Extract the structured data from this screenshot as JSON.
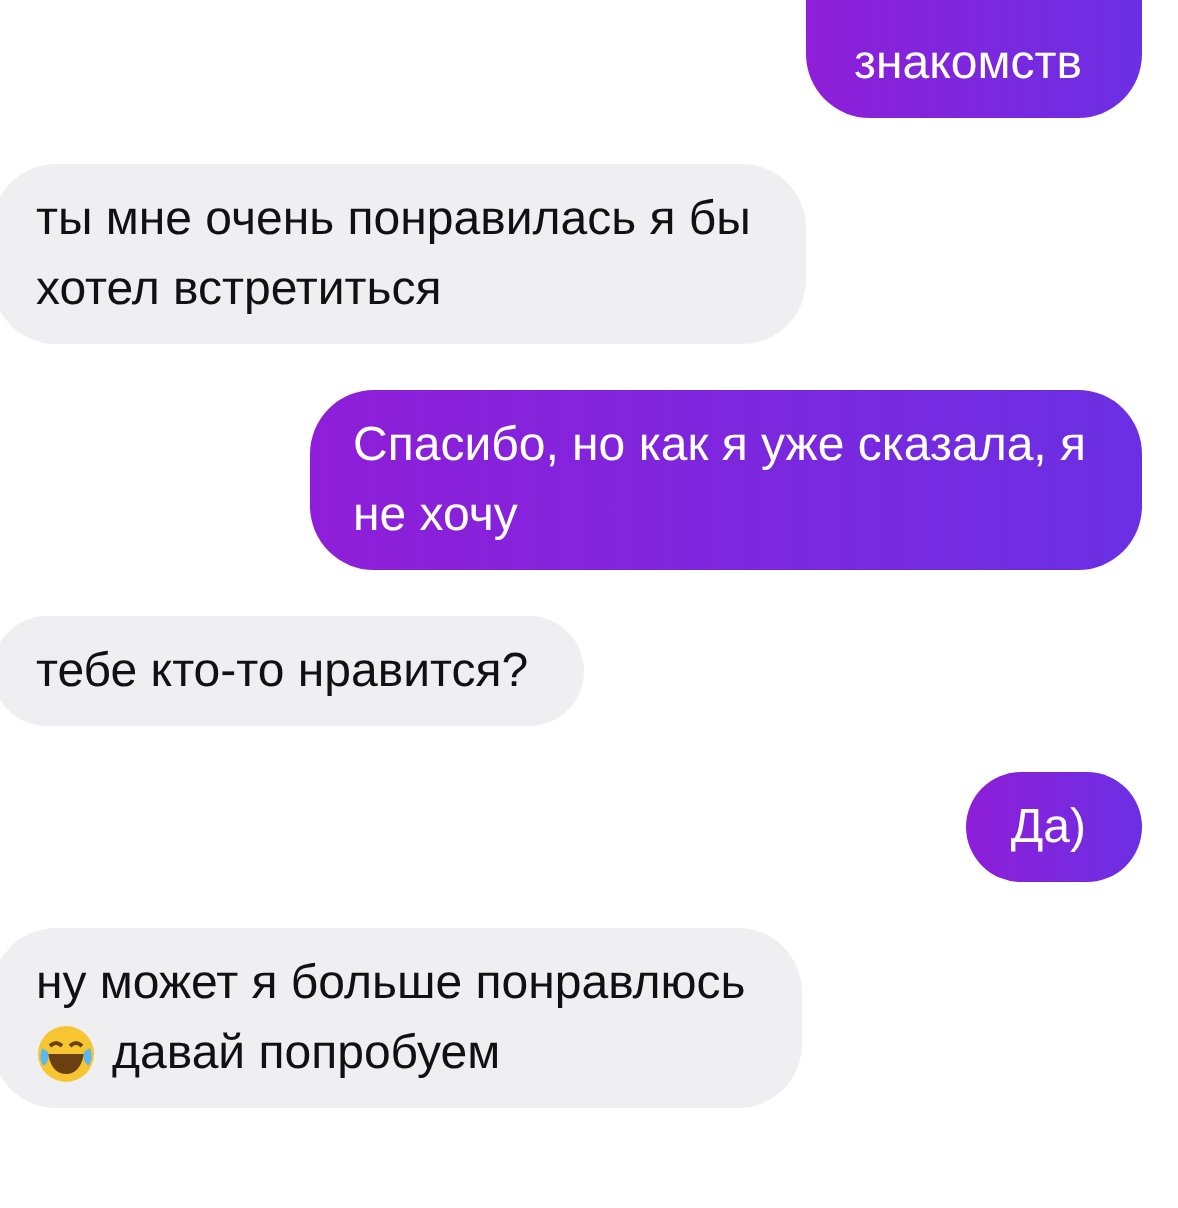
{
  "messages": [
    {
      "kind": "outgoing",
      "lines": [
        "знакомств"
      ],
      "cut_top": true
    },
    {
      "kind": "incoming",
      "lines": [
        "ты мне очень понравилась я бы",
        "хотел встретиться"
      ],
      "cut_top": false
    },
    {
      "kind": "outgoing",
      "lines": [
        "Спасибо, но как я уже сказала, я",
        "не хочу"
      ],
      "cut_top": false
    },
    {
      "kind": "incoming",
      "lines": [
        "тебе кто-то нравится?"
      ],
      "cut_top": false
    },
    {
      "kind": "outgoing",
      "lines": [
        "Да)"
      ],
      "cut_top": false
    },
    {
      "kind": "incoming",
      "lines": [
        "ну может я больше понравлюсь",
        "давай попробуем"
      ],
      "laughing_emoji": true,
      "cut_top": false
    }
  ]
}
